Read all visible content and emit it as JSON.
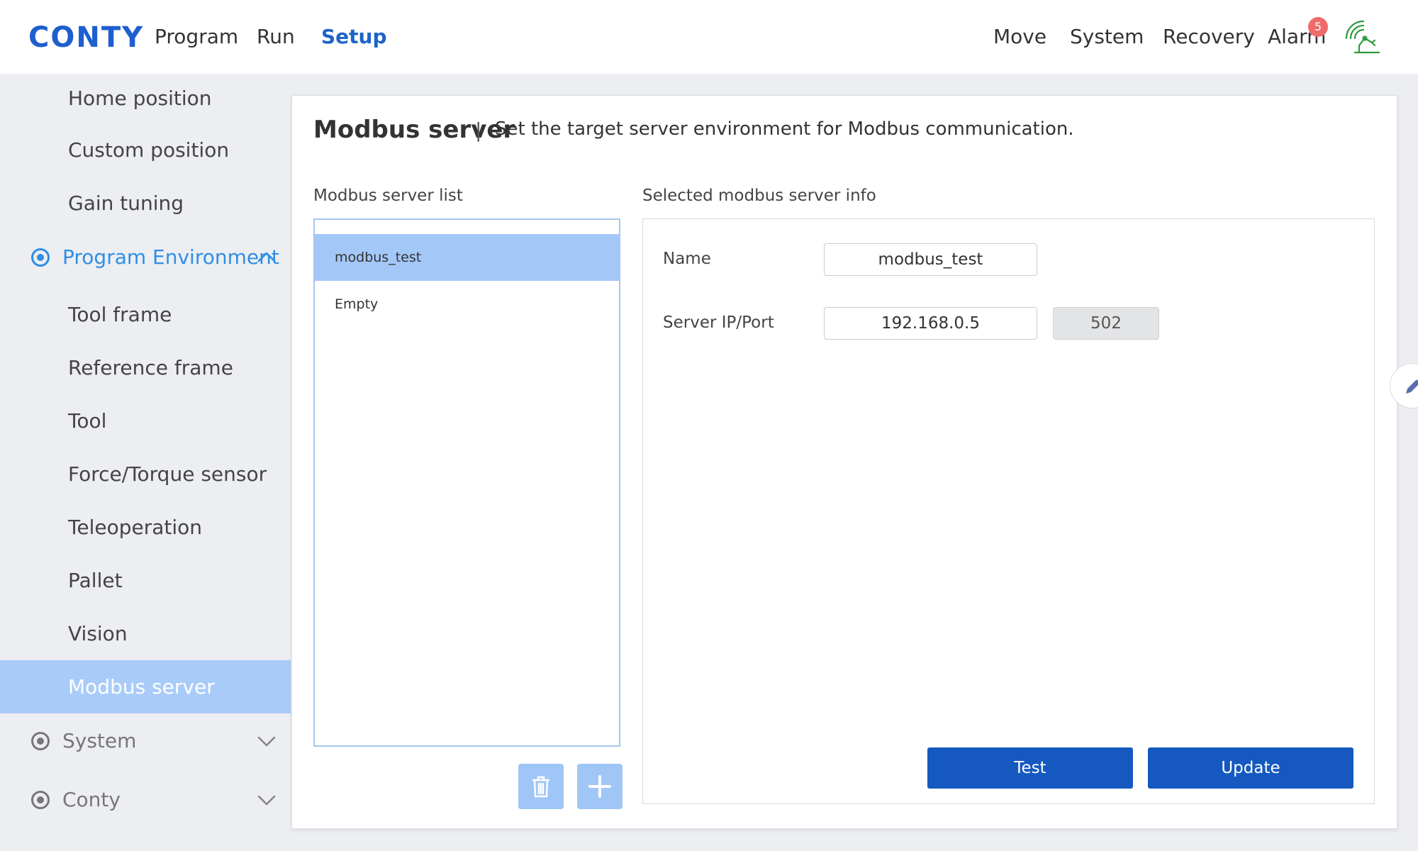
{
  "app": {
    "logo": "CONTY"
  },
  "topnav": {
    "left": [
      "Program",
      "Run",
      "Setup"
    ],
    "active": "Setup",
    "right": [
      "Move",
      "System",
      "Recovery",
      "Alarm"
    ],
    "alarm_count": "5"
  },
  "sidebar": {
    "items_top": [
      "Home position",
      "Custom position",
      "Gain tuning"
    ],
    "group_program_env": "Program Environment",
    "items": [
      "Tool frame",
      "Reference frame",
      "Tool",
      "Force/Torque sensor",
      "Teleoperation",
      "Pallet",
      "Vision",
      "Modbus server"
    ],
    "selected": "Modbus server",
    "group_system": "System",
    "group_conty": "Conty"
  },
  "main": {
    "title": "Modbus server",
    "separator": "|",
    "description": "Set the target server environment for Modbus communication.",
    "list_label": "Modbus server list",
    "list": [
      "modbus_test",
      "Empty"
    ],
    "info_label": "Selected modbus server info",
    "name_label": "Name",
    "name_value": "modbus_test",
    "ip_label": "Server IP/Port",
    "ip_value": "192.168.0.5",
    "port_value": "502",
    "test_button": "Test",
    "update_button": "Update"
  },
  "colors": {
    "accent": "#1e63c8",
    "selected_bg": "#a9cbf8",
    "primary_button": "#1559c0",
    "badge": "#f06a6a",
    "signal": "#2e9a3e"
  }
}
